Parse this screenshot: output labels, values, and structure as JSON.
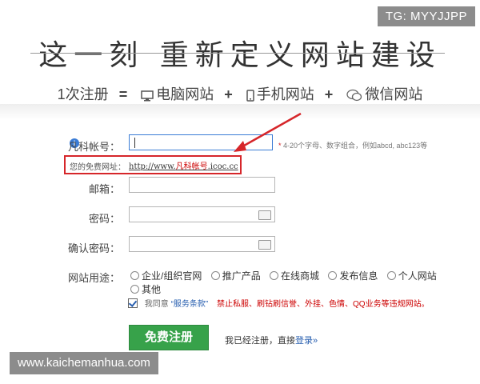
{
  "badge": "TG: MYYJJPP",
  "headline": "这一刻 重新定义网站建设",
  "subline": {
    "count": "1次注册",
    "equals": "=",
    "pc": "电脑网站",
    "plus": "+",
    "mobile": "手机网站",
    "wechat": "微信网站"
  },
  "form": {
    "account_label": "凡科帐号：",
    "account_hint_star": "*",
    "account_hint": "4-20个字母、数字组合，例如abcd, abc123等",
    "free_url_label": "您的免费网址：",
    "free_url_prefix": "http://www.",
    "free_url_account": "凡科帐号",
    "free_url_suffix": ".icoc.cc",
    "email_label": "邮箱：",
    "password_label": "密码：",
    "confirm_label": "确认密码：",
    "purpose_label": "网站用途：",
    "purposes": [
      "企业/组织官网",
      "推广产品",
      "在线商城",
      "发布信息",
      "个人网站",
      "其他"
    ],
    "agree_prefix": "我同意",
    "terms": "“服务条款”",
    "warning": "禁止私服、刷钻刷信誉、外挂、色情、QQ业务等违规网站。",
    "register_button": "免费注册",
    "already_text": "我已经注册，直接",
    "login_link": "登录",
    "login_arrow": "»"
  },
  "watermark": "www.kaichemanhua.com",
  "colors": {
    "accent_green": "#37a24a",
    "highlight_red": "#d6262a",
    "link_blue": "#2a60b0"
  }
}
